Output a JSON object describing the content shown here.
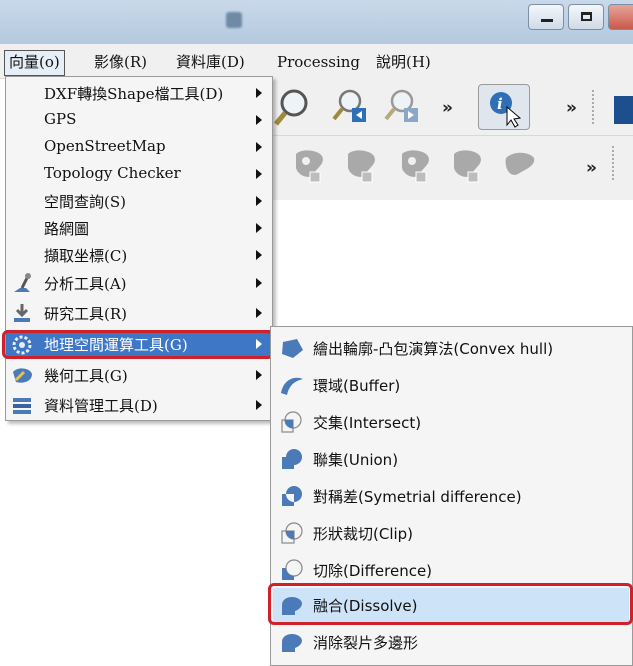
{
  "menubar": {
    "items": [
      "向量(o)",
      "影像(R)",
      "資料庫(D)",
      "Processing",
      "說明(H)"
    ]
  },
  "vector_menu": {
    "items": [
      {
        "label": "DXF轉換Shape檔工具(D)",
        "icon": "none"
      },
      {
        "label": "GPS",
        "icon": "none"
      },
      {
        "label": "OpenStreetMap",
        "icon": "none"
      },
      {
        "label": "Topology Checker",
        "icon": "none"
      },
      {
        "label": "空間查詢(S)",
        "icon": "none"
      },
      {
        "label": "路網圖",
        "icon": "none"
      },
      {
        "label": "擷取坐標(C)",
        "icon": "none"
      },
      {
        "label": "分析工具(A)",
        "icon": "analysis-icon"
      },
      {
        "label": "研究工具(R)",
        "icon": "research-icon"
      },
      {
        "label": "地理空間運算工具(G)",
        "icon": "geoprocessing-icon"
      },
      {
        "label": "幾何工具(G)",
        "icon": "geometry-icon"
      },
      {
        "label": "資料管理工具(D)",
        "icon": "data-management-icon"
      }
    ]
  },
  "geoprocessing_submenu": {
    "items": [
      {
        "label": "繪出輪廓-凸包演算法(Convex hull)",
        "icon": "convex-hull-icon"
      },
      {
        "label": "環域(Buffer)",
        "icon": "buffer-icon"
      },
      {
        "label": "交集(Intersect)",
        "icon": "intersect-icon"
      },
      {
        "label": "聯集(Union)",
        "icon": "union-icon"
      },
      {
        "label": "對稱差(Symetrial difference)",
        "icon": "symmetrical-difference-icon"
      },
      {
        "label": "形狀裁切(Clip)",
        "icon": "clip-icon"
      },
      {
        "label": "切除(Difference)",
        "icon": "difference-icon"
      },
      {
        "label": "融合(Dissolve)",
        "icon": "dissolve-icon"
      },
      {
        "label": "消除裂片多邊形",
        "icon": "eliminate-sliver-icon"
      }
    ],
    "highlighted": "融合(Dissolve)"
  },
  "toolbar": {
    "overflow_label": "»"
  },
  "colors": {
    "highlight_blue": "#3f77c7",
    "annotation_red": "#d0202a",
    "submenu_hover": "#cde3f7"
  }
}
